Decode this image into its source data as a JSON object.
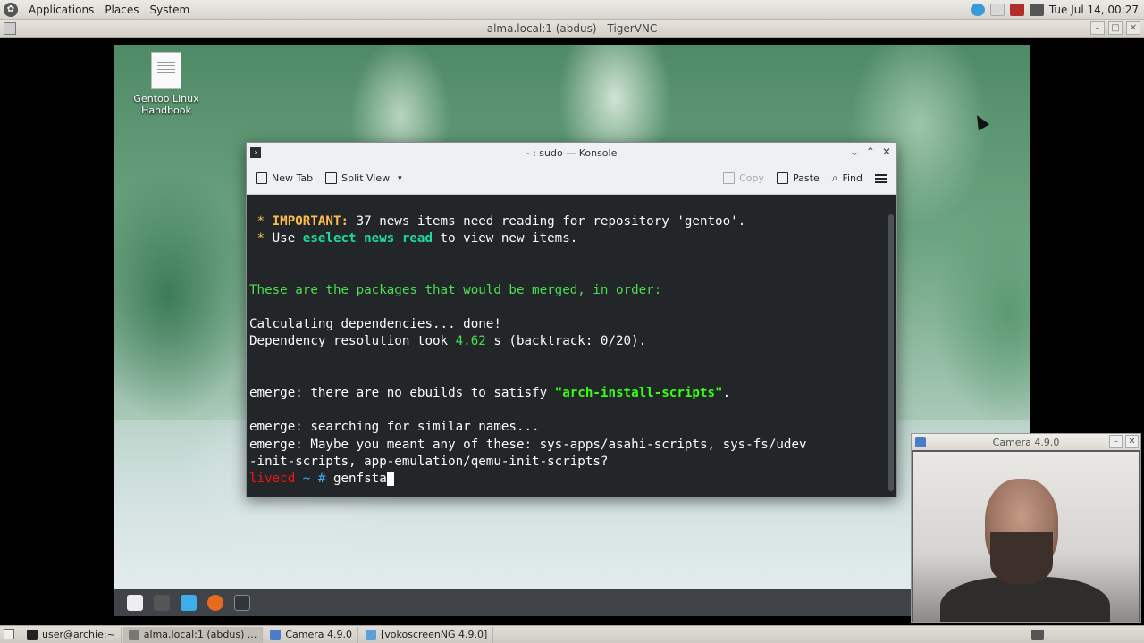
{
  "host_panel": {
    "menus": [
      "Applications",
      "Places",
      "System"
    ],
    "clock": "Tue Jul 14, 00:27"
  },
  "vnc_window": {
    "title": "alma.local:1 (abdus) - TigerVNC"
  },
  "desktop": {
    "icon_label_line1": "Gentoo Linux",
    "icon_label_line2": "Handbook"
  },
  "konsole": {
    "title": "- : sudo — Konsole",
    "toolbar": {
      "new_tab": "New Tab",
      "split_view": "Split View",
      "copy": "Copy",
      "paste": "Paste",
      "find": "Find"
    },
    "terminal": {
      "l1_star": " * ",
      "l1_important": "IMPORTANT:",
      "l1_rest": " 37 news items need reading for repository 'gentoo'.",
      "l2_star": " * ",
      "l2_use": "Use ",
      "l2_cmd": "eselect news read",
      "l2_rest": " to view new items.",
      "l3": "These are the packages that would be merged, in order:",
      "l4": "Calculating dependencies... done!",
      "l5_a": "Dependency resolution took ",
      "l5_num": "4.62",
      "l5_b": " s (backtrack: 0/20).",
      "l6_a": "emerge: there are no ebuilds to satisfy ",
      "l6_pkg": "\"arch-install-scripts\"",
      "l6_b": ".",
      "l7": "emerge: searching for similar names...",
      "l8": "emerge: Maybe you meant any of these: sys-apps/asahi-scripts, sys-fs/udev",
      "l9": "-init-scripts, app-emulation/qemu-init-scripts?",
      "prompt_host": "livecd",
      "prompt_path": " ~ #",
      "command": " genfsta"
    }
  },
  "camera_window": {
    "title": "Camera 4.9.0"
  },
  "taskbar": {
    "items": [
      "user@archie:~",
      "alma.local:1 (abdus) ...",
      "Camera 4.9.0",
      "[vokoscreenNG 4.9.0]"
    ]
  },
  "colors": {
    "terminal_bg": "#232629",
    "important_yellow": "#fdbc4b",
    "command_green": "#1cdc9a",
    "prompt_red": "#ed1515"
  }
}
